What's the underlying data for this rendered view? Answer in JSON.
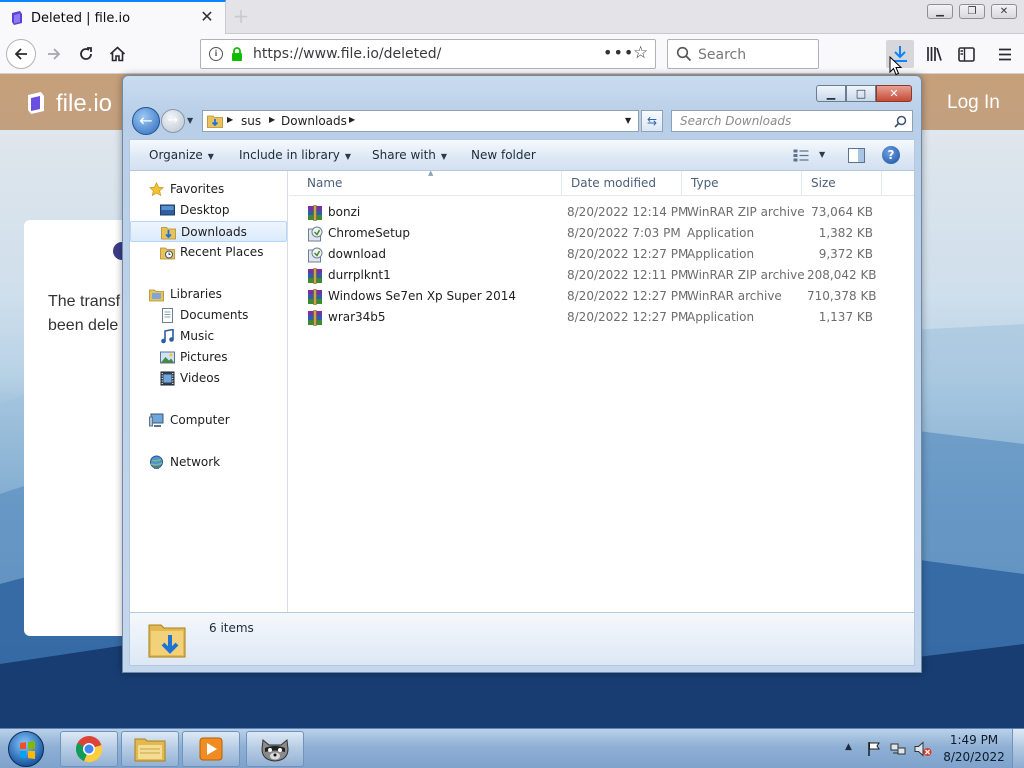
{
  "browser": {
    "tab": {
      "title": "Deleted | file.io"
    },
    "url": "https://www.file.io/deleted/",
    "search_placeholder": "Search",
    "icons": [
      "back-icon",
      "forward-icon",
      "reload-icon",
      "home-icon",
      "info-icon",
      "lock-icon",
      "page-actions-icon",
      "bookmark-star-icon",
      "search-icon",
      "downloads-icon",
      "library-icon",
      "sidebar-icon",
      "hamburger-menu-icon"
    ]
  },
  "webpage": {
    "logo": "file.io",
    "login": "Log In",
    "message_partial": "The transf\nbeen dele"
  },
  "explorer": {
    "address": {
      "crumbs": [
        "sus",
        "Downloads"
      ]
    },
    "search_placeholder": "Search Downloads",
    "toolbar": {
      "organize": "Organize",
      "include_in_library": "Include in library",
      "share_with": "Share with",
      "new_folder": "New folder"
    },
    "nav": {
      "favorites": "Favorites",
      "desktop": "Desktop",
      "downloads": "Downloads",
      "recent_places": "Recent Places",
      "libraries": "Libraries",
      "documents": "Documents",
      "music": "Music",
      "pictures": "Pictures",
      "videos": "Videos",
      "computer": "Computer",
      "network": "Network"
    },
    "columns": {
      "name": "Name",
      "date": "Date modified",
      "type": "Type",
      "size": "Size"
    },
    "files": [
      {
        "name": "bonzi",
        "date": "8/20/2022 12:14 PM",
        "type": "WinRAR ZIP archive",
        "size": "73,064 KB",
        "icon": "winrar-icon"
      },
      {
        "name": "ChromeSetup",
        "date": "8/20/2022 7:03 PM",
        "type": "Application",
        "size": "1,382 KB",
        "icon": "installer-icon"
      },
      {
        "name": "download",
        "date": "8/20/2022 12:27 PM",
        "type": "Application",
        "size": "9,372 KB",
        "icon": "installer-icon"
      },
      {
        "name": "durrplknt1",
        "date": "8/20/2022 12:11 PM",
        "type": "WinRAR ZIP archive",
        "size": "208,042 KB",
        "icon": "winrar-icon"
      },
      {
        "name": "Windows Se7en Xp Super 2014",
        "date": "8/20/2022 12:27 PM",
        "type": "WinRAR archive",
        "size": "710,378 KB",
        "icon": "winrar-icon"
      },
      {
        "name": "wrar34b5",
        "date": "8/20/2022 12:27 PM",
        "type": "Application",
        "size": "1,137 KB",
        "icon": "winrar-icon"
      }
    ],
    "details": {
      "count": "6 items"
    }
  },
  "taskbar": {
    "time": "1:49 PM",
    "date": "8/20/2022"
  },
  "colors": {
    "accent": "#0a84ff",
    "selection": "#dbeafc",
    "lock_green": "#12bc00"
  }
}
